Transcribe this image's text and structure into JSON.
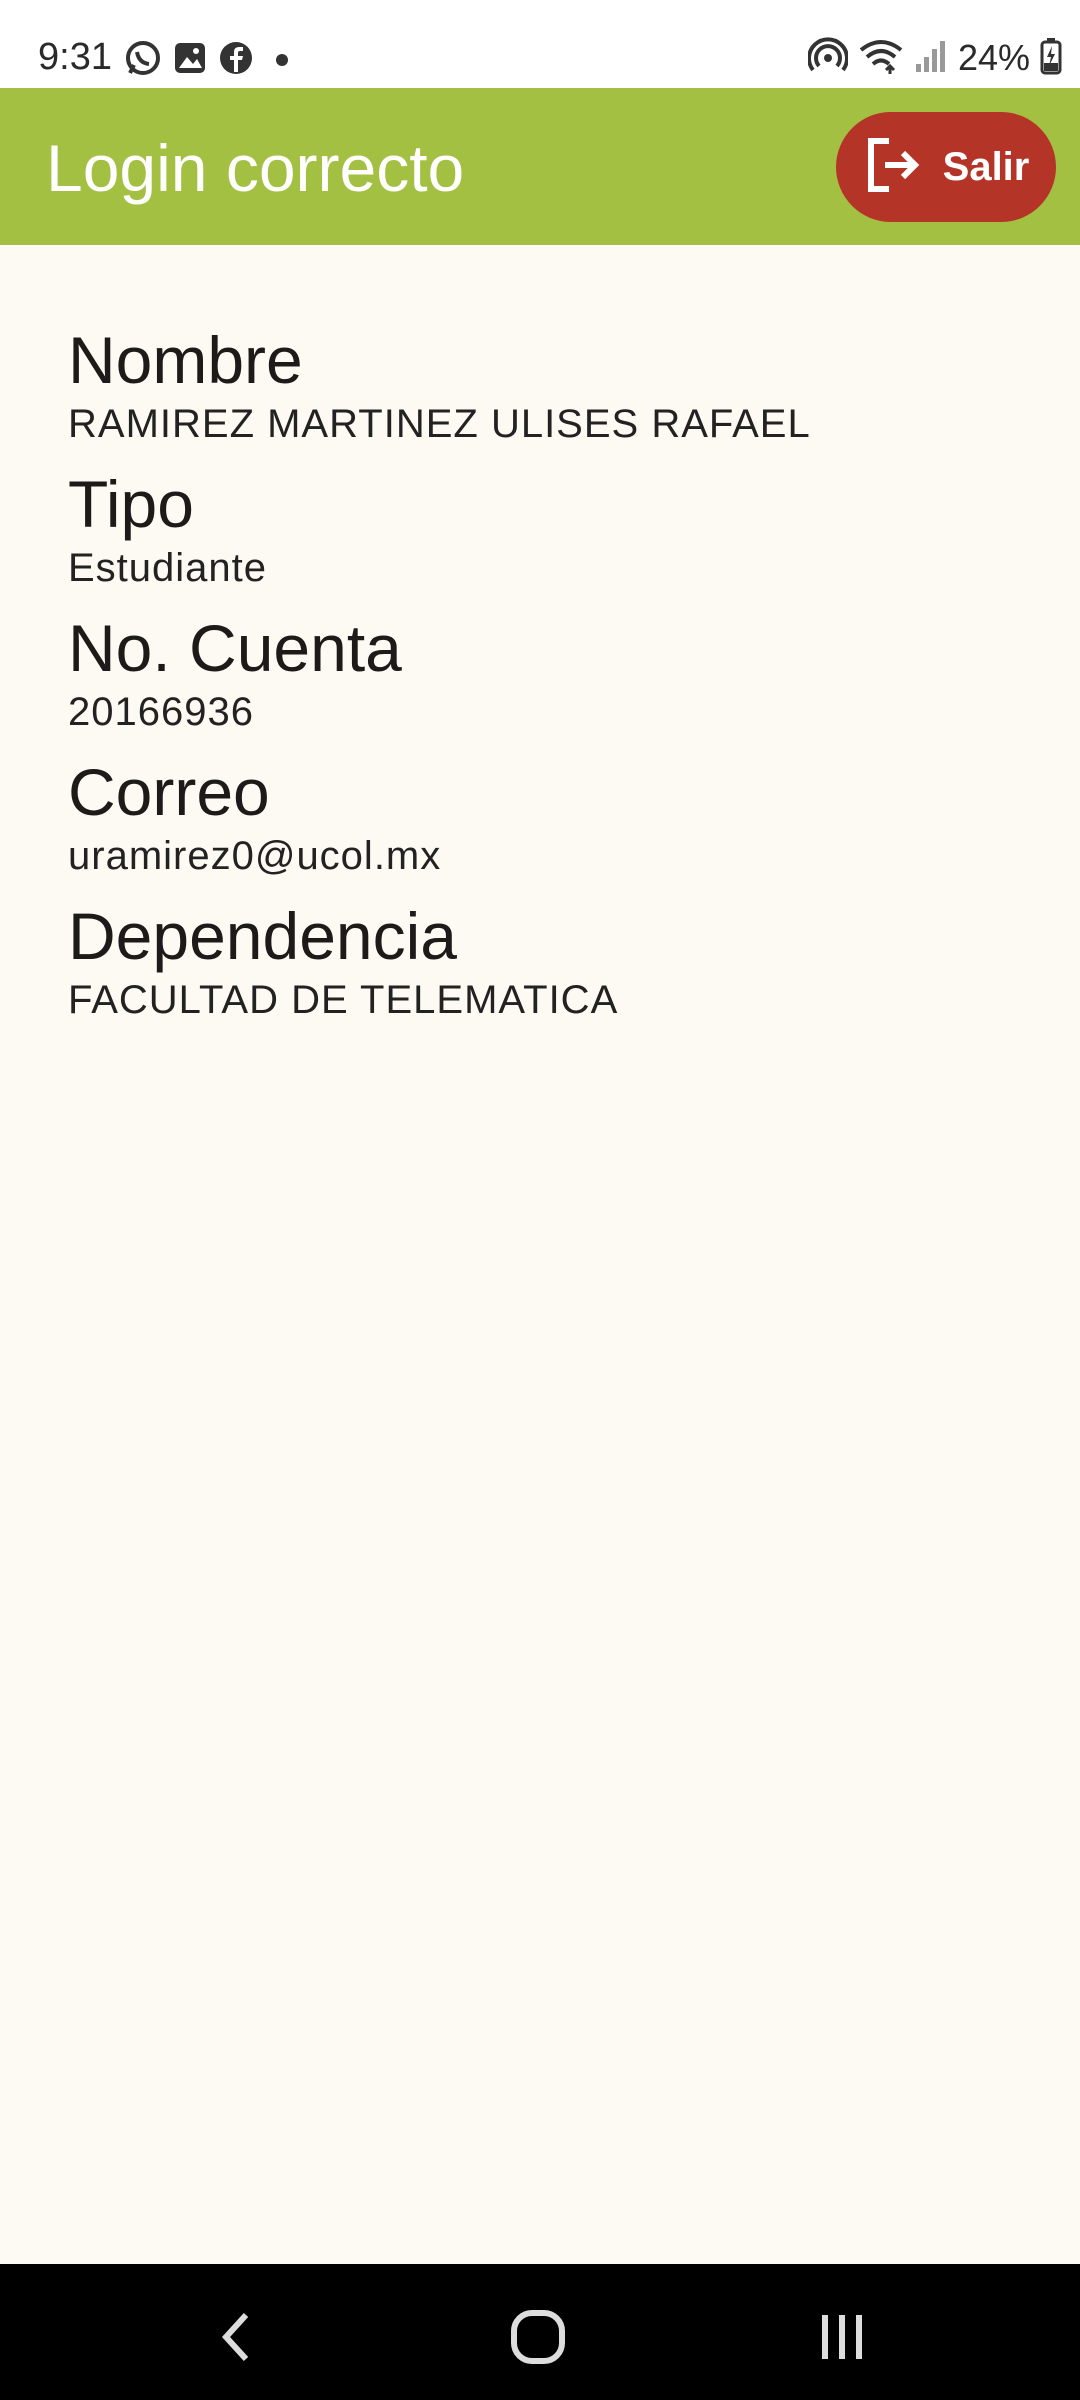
{
  "status_bar": {
    "time": "9:31",
    "battery": "24%",
    "left_icons": [
      "whatsapp-icon",
      "gallery-icon",
      "facebook-icon",
      "notification-dot"
    ],
    "right_icons": [
      "hotspot-icon",
      "wifi-icon",
      "signal-icon",
      "battery-icon"
    ]
  },
  "app_bar": {
    "title": "Login correcto",
    "logout_label": "Salir",
    "accent_color": "#a4c043",
    "logout_color": "#b43428"
  },
  "profile": {
    "fields": [
      {
        "label": "Nombre",
        "value": "RAMIREZ MARTINEZ ULISES RAFAEL"
      },
      {
        "label": "Tipo",
        "value": "Estudiante"
      },
      {
        "label": "No. Cuenta",
        "value": "20166936"
      },
      {
        "label": "Correo",
        "value": "uramirez0@ucol.mx"
      },
      {
        "label": "Dependencia",
        "value": "FACULTAD DE TELEMATICA"
      }
    ]
  },
  "nav_bar": {
    "buttons": [
      "back-icon",
      "home-icon",
      "recent-apps-icon"
    ]
  }
}
